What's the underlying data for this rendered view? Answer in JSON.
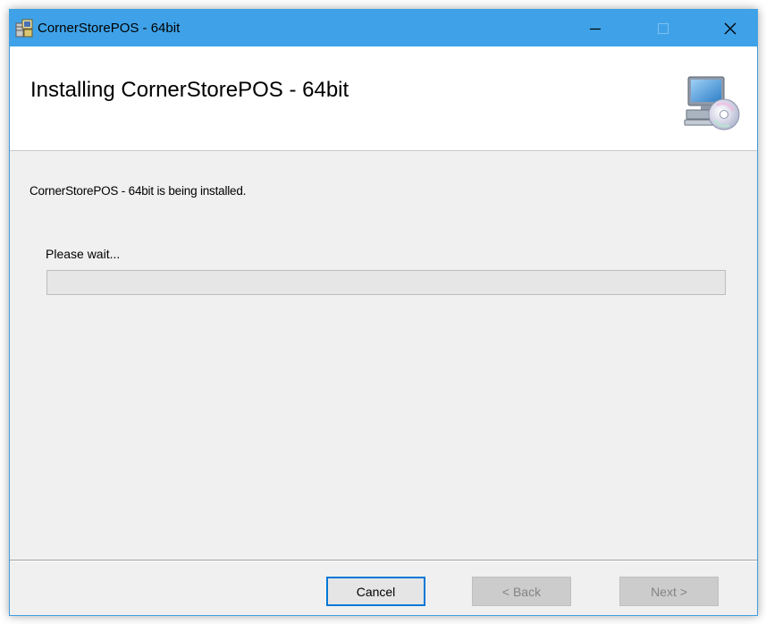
{
  "window": {
    "title": "CornerStorePOS - 64bit",
    "controls": {
      "minimize_icon": "minimize-icon",
      "maximize_icon": "maximize-icon",
      "close_icon": "close-icon"
    },
    "accent_color": "#3fa2e8"
  },
  "header": {
    "title": "Installing CornerStorePOS - 64bit",
    "icon": "computer-disc-icon"
  },
  "body": {
    "status_text": "CornerStorePOS - 64bit is being installed.",
    "wait_label": "Please wait...",
    "progress_fraction": 0.0
  },
  "footer": {
    "cancel_label": "Cancel",
    "back_label": "< Back",
    "next_label": "Next >",
    "back_enabled": false,
    "next_enabled": false
  }
}
